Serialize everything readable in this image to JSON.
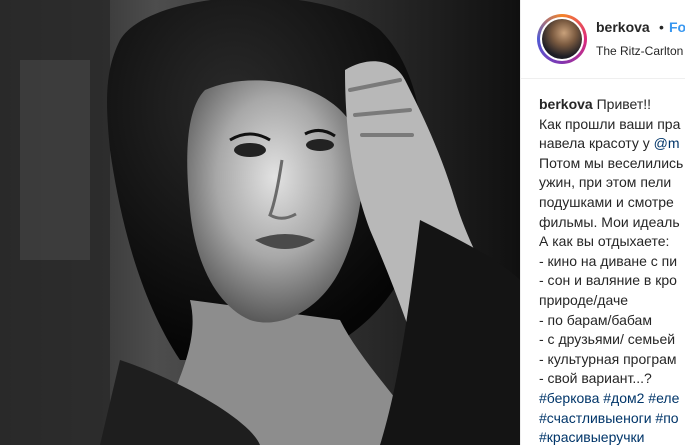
{
  "post": {
    "username": "berkova",
    "separator": "•",
    "follow_label": "Foll",
    "location": "The Ritz-Carlton"
  },
  "caption": {
    "username": "berkova",
    "line1_text": " Привет!!",
    "line2": "Как прошли ваши пра",
    "line3_text": "навела красоту у ",
    "line3_mention": "@m",
    "line4": "Потом мы веселились",
    "line5": "ужин, при этом пели",
    "line6": "подушками и смотре",
    "line7": "фильмы. Мои идеаль",
    "line8": "А как вы отдыхаете:",
    "line9": "- кино на диване с пи",
    "line10": "- сон и валяние в кро",
    "line11": "природе/даче",
    "line12": "- по барам/бабам",
    "line13": "- с друзьями/ семьей",
    "line14": "- культурная програм",
    "line15": "- свой вариант...?",
    "tags_line1": "#беркова #дом2 #еле",
    "tags_line2": "#счастливыеноги #по",
    "tags_line3": "#красивыеручки"
  },
  "colors": {
    "follow": "#3897f0",
    "link": "#003569",
    "text": "#262626"
  },
  "icons": {
    "avatar": "profile-avatar"
  }
}
